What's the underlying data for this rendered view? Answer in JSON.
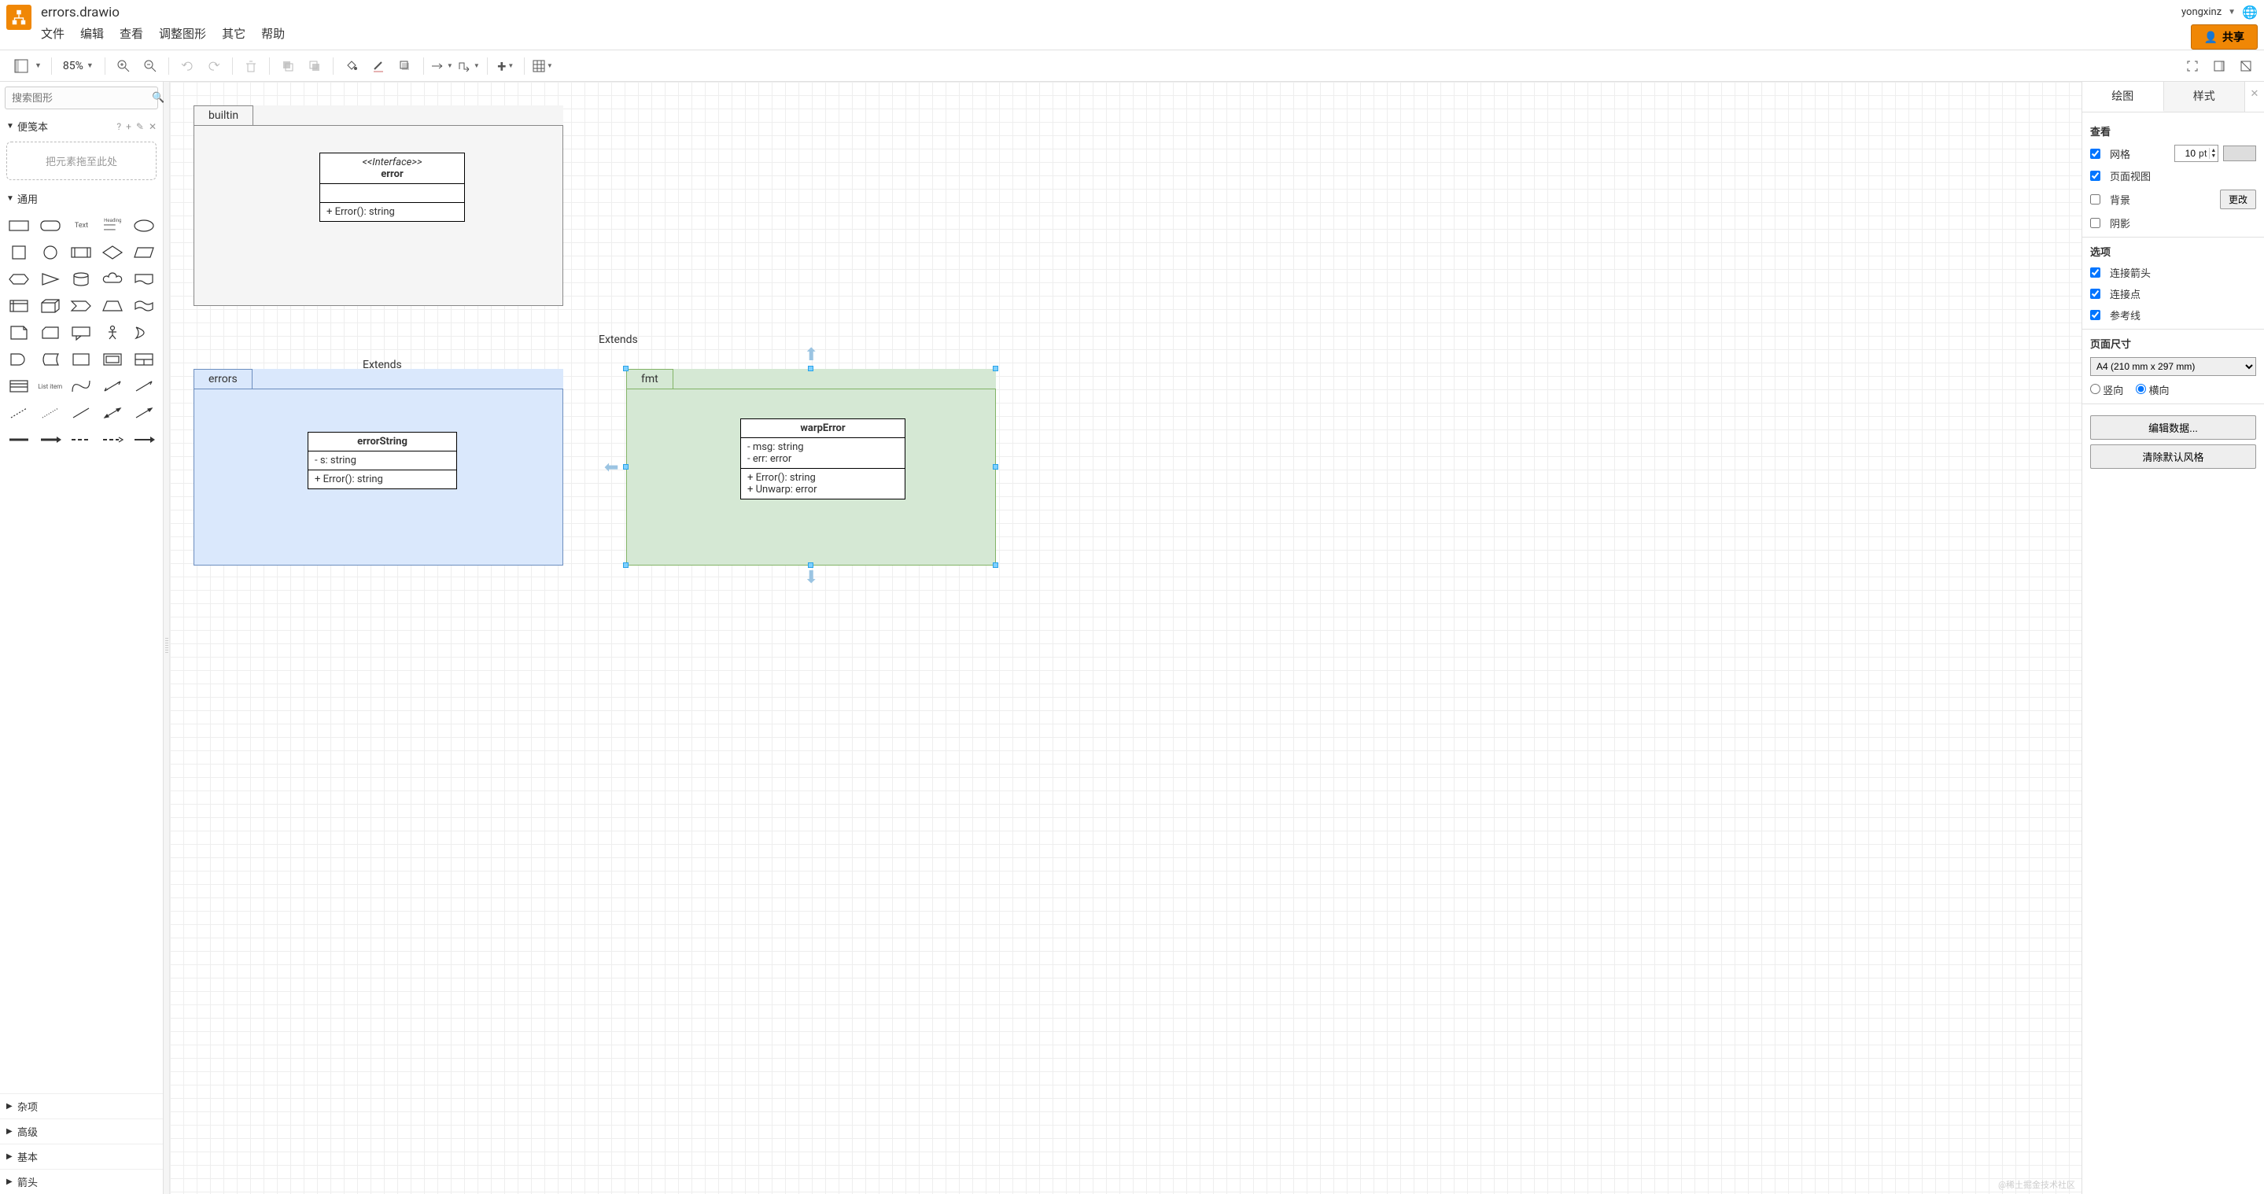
{
  "header": {
    "filename": "errors.drawio",
    "menus": [
      "文件",
      "编辑",
      "查看",
      "调整图形",
      "其它",
      "帮助"
    ],
    "user": "yongxinz",
    "share_label": "共享"
  },
  "toolbar": {
    "zoom": "85%"
  },
  "sidebar_left": {
    "search_placeholder": "搜索图形",
    "scratchpad": {
      "title": "便笺本",
      "help": "?",
      "drop_hint": "把元素拖至此处"
    },
    "sections": {
      "general": "通用",
      "misc": "杂项",
      "advanced": "高级",
      "basic": "基本",
      "arrows": "箭头"
    }
  },
  "diagram": {
    "packages": {
      "builtin": {
        "label": "builtin"
      },
      "errors": {
        "label": "errors"
      },
      "fmt": {
        "label": "fmt"
      }
    },
    "classes": {
      "error": {
        "stereo": "<<Interface>>",
        "name": "error",
        "attrs": [],
        "ops": [
          "+ Error(): string"
        ]
      },
      "errorString": {
        "name": "errorString",
        "attrs": [
          "- s: string"
        ],
        "ops": [
          "+ Error(): string"
        ]
      },
      "warpError": {
        "name": "warpError",
        "attrs": [
          "- msg: string",
          "- err: error"
        ],
        "ops": [
          "+ Error(): string",
          "+ Unwarp: error"
        ]
      }
    },
    "edges": {
      "e1": {
        "label": "Extends"
      },
      "e2": {
        "label": "Extends"
      }
    }
  },
  "sidebar_right": {
    "tabs": {
      "tab1": "绘图",
      "tab2": "样式"
    },
    "view": {
      "title": "查看",
      "grid": "网格",
      "grid_val": "10",
      "grid_unit": "pt",
      "pageview": "页面视图",
      "bg": "背景",
      "bg_btn": "更改",
      "shadow": "阴影"
    },
    "options": {
      "title": "选项",
      "arrows": "连接箭头",
      "points": "连接点",
      "guides": "参考线"
    },
    "pagesize": {
      "title": "页面尺寸",
      "selected": "A4 (210 mm x 297 mm)",
      "portrait": "竖向",
      "landscape": "横向"
    },
    "buttons": {
      "editdata": "编辑数据...",
      "clearstyle": "清除默认风格"
    }
  },
  "watermark": "@稀土掘金技术社区"
}
